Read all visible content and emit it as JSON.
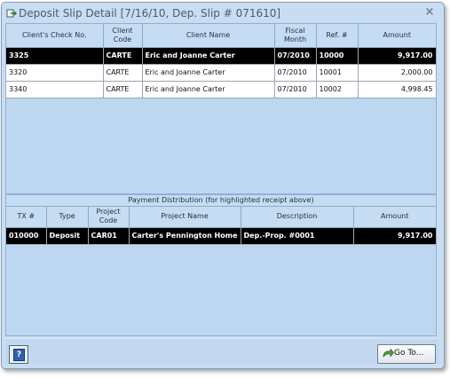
{
  "window": {
    "title": "Deposit Slip Detail [7/16/10, Dep. Slip # 071610]",
    "close_glyph": "×"
  },
  "receipts": {
    "headers": [
      "Client's Check No.",
      "Client Code",
      "Client Name",
      "Fiscal Month",
      "Ref. #",
      "Amount"
    ],
    "rows": [
      {
        "check_no": "3325",
        "client_code": "CARTE",
        "client_name": "Eric and Joanne Carter",
        "fiscal_month": "07/2010",
        "ref_no": "10000",
        "amount": "9,917.00",
        "selected": true
      },
      {
        "check_no": "3320",
        "client_code": "CARTE",
        "client_name": "Eric and Joanne Carter",
        "fiscal_month": "07/2010",
        "ref_no": "10001",
        "amount": "2,000.00",
        "selected": false
      },
      {
        "check_no": "3340",
        "client_code": "CARTE",
        "client_name": "Eric and Joanne Carter",
        "fiscal_month": "07/2010",
        "ref_no": "10002",
        "amount": "4,998.45",
        "selected": false
      }
    ]
  },
  "distribution": {
    "title": "Payment Distribution (for highlighted receipt above)",
    "headers": [
      "TX #",
      "Type",
      "Project Code",
      "Project Name",
      "Description",
      "Amount"
    ],
    "rows": [
      {
        "tx_no": "010000",
        "type": "Deposit",
        "project_code": "CAR01",
        "project_name": "Carter's Pennington Home",
        "description": "Dep.-Prop. #0001",
        "amount": "9,917.00",
        "selected": true
      }
    ]
  },
  "footer": {
    "help_glyph": "?",
    "goto_label": "Go To...",
    "goto_icon": "green-arrow-icon"
  }
}
